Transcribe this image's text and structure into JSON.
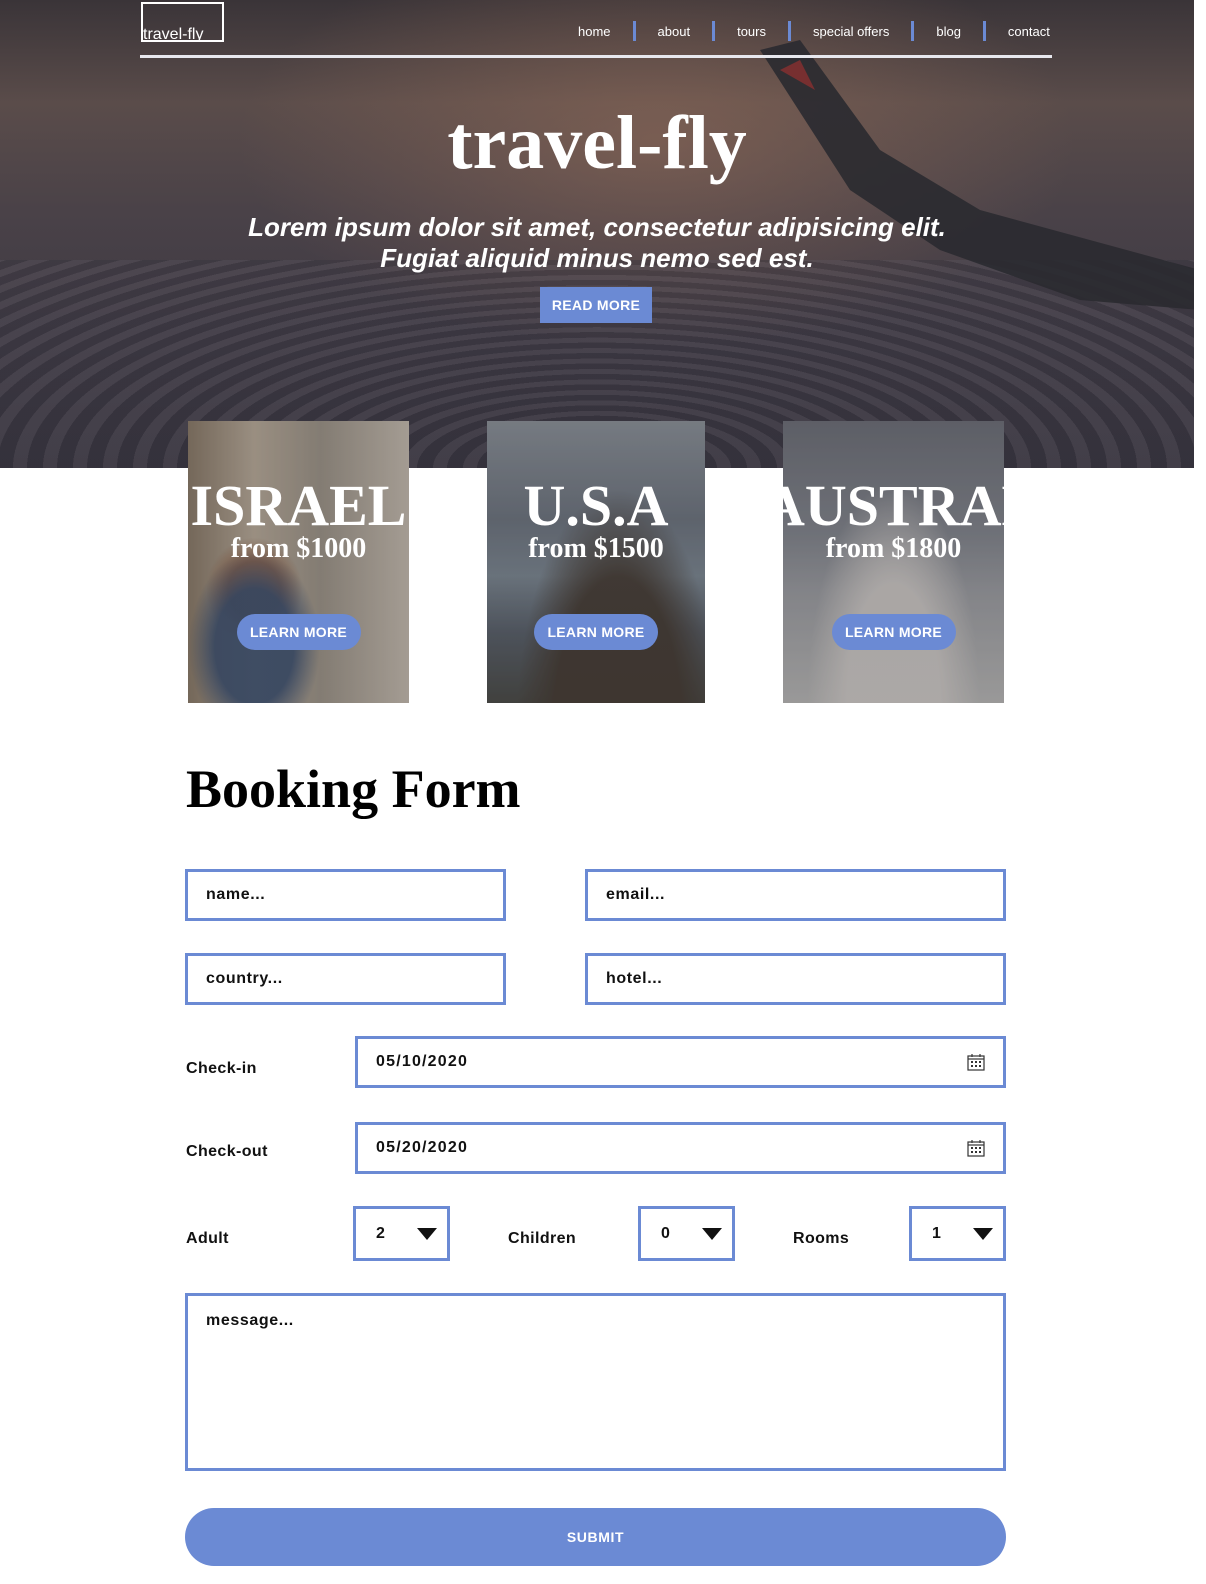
{
  "brand": {
    "logo": "travel-fly"
  },
  "nav": {
    "items": [
      "home",
      "about",
      "tours",
      "special offers",
      "blog",
      "contact"
    ]
  },
  "hero": {
    "title": "travel-fly",
    "subtitle_line1": "Lorem ipsum dolor sit amet, consectetur adipisicing elit.",
    "subtitle_line2": "Fugiat aliquid minus nemo sed est.",
    "cta": "READ MORE"
  },
  "tours": [
    {
      "country": "ISRAEL",
      "price": "from $1000",
      "cta": "LEARN MORE"
    },
    {
      "country": "U.S.A",
      "price": "from $1500",
      "cta": "LEARN MORE"
    },
    {
      "country": "AUSTRALIA",
      "price": "from $1800",
      "cta": "LEARN MORE"
    }
  ],
  "booking": {
    "title": "Booking Form",
    "name_placeholder": "name...",
    "email_placeholder": "email...",
    "country_placeholder": "country...",
    "hotel_placeholder": "hotel...",
    "checkin_label": "Check-in",
    "checkin_value": "05/10/2020",
    "checkout_label": "Check-out",
    "checkout_value": "05/20/2020",
    "adult_label": "Adult",
    "adult_value": "2",
    "children_label": "Children",
    "children_value": "0",
    "rooms_label": "Rooms",
    "rooms_value": "1",
    "message_placeholder": "message...",
    "submit": "SUBMIT"
  },
  "colors": {
    "accent": "#6b8ad4",
    "nav_separator": "#6b8ad4"
  },
  "icons": {
    "date_picker": "calendar-icon",
    "dropdown": "triangle-down-icon"
  }
}
